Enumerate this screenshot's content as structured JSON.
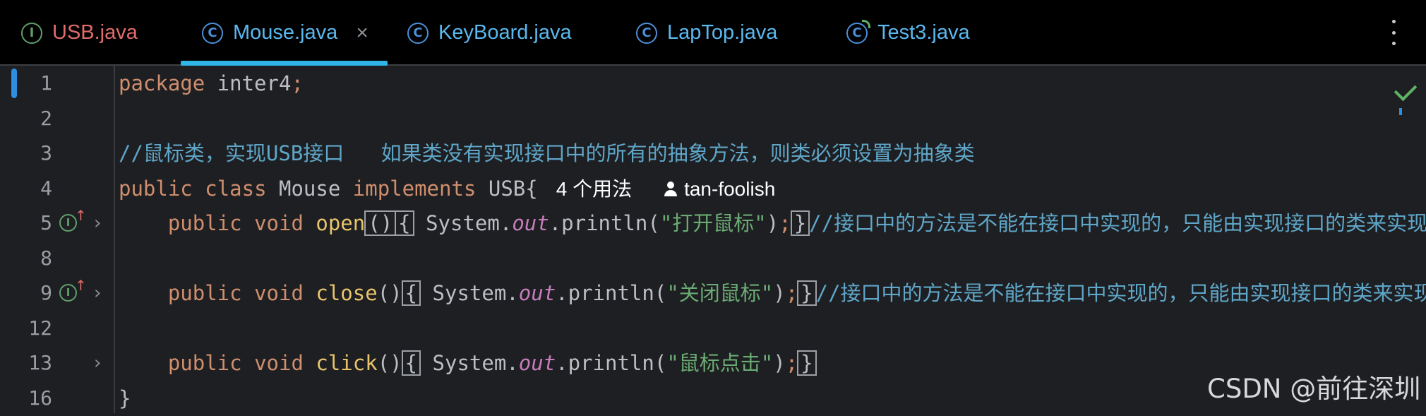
{
  "tabs": [
    {
      "label": "USB.java",
      "icon": "interface-icon",
      "icon_letter": "I",
      "active": false
    },
    {
      "label": "Mouse.java",
      "icon": "class-icon",
      "icon_letter": "C",
      "active": true,
      "close": "×"
    },
    {
      "label": "KeyBoard.java",
      "icon": "class-icon",
      "icon_letter": "C",
      "active": false
    },
    {
      "label": "LapTop.java",
      "icon": "class-icon",
      "icon_letter": "C",
      "active": false
    },
    {
      "label": "Test3.java",
      "icon": "runnable-class-icon",
      "icon_letter": "C",
      "active": false
    }
  ],
  "gutter": {
    "line_numbers": [
      "1",
      "2",
      "3",
      "4",
      "5",
      "8",
      "9",
      "12",
      "13",
      "16"
    ],
    "impl_letter": "I",
    "impl_arrow": "↑",
    "fold": "›"
  },
  "code": {
    "l1": {
      "kw": "package",
      "name": " inter4",
      "semi": ";"
    },
    "l3": {
      "comment": "//鼠标类，实现USB接口   如果类没有实现接口中的所有的抽象方法，则类必须设置为抽象类"
    },
    "l4": {
      "kw1": "public",
      "kw2": "class",
      "name": "Mouse",
      "kw3": "implements",
      "iface": "USB{",
      "usages": "4 个用法",
      "author": "tan-foolish"
    },
    "l5": {
      "kw1": "public",
      "kw2": "void",
      "fn": "open",
      "parens": "()",
      "brace_open": "{",
      "sys": " System.",
      "out": "out",
      "println": ".println(",
      "str": "\"打开鼠标\"",
      "paren_close": ")",
      "semi": ";",
      "brace_close": "}",
      "comment": "//接口中的方法是不能在接口中实现的，只能由实现接口的类来实现"
    },
    "l9": {
      "kw1": "public",
      "kw2": "void",
      "fn": "close",
      "parens": "()",
      "brace_open": "{",
      "sys": " System.",
      "out": "out",
      "println": ".println(",
      "str": "\"关闭鼠标\"",
      "paren_close": ")",
      "semi": ";",
      "brace_close": "}",
      "comment": "//接口中的方法是不能在接口中实现的，只能由实现接口的类来实现"
    },
    "l13": {
      "kw1": "public",
      "kw2": "void",
      "fn": "click",
      "parens": "()",
      "brace_open": "{",
      "sys": " System.",
      "out": "out",
      "println": ".println(",
      "str": "\"鼠标点击\"",
      "paren_close": ")",
      "semi": ";",
      "brace_close": "}"
    },
    "l16": {
      "brace": "}"
    }
  },
  "watermark": "CSDN @前往深圳",
  "colors": {
    "keyword": "#cf8e6d",
    "function": "#e8c46b",
    "string": "#6aab73",
    "comment": "#5fa6c8",
    "static_field": "#c77dbb",
    "active_tab_underline": "#2fb5e6"
  }
}
